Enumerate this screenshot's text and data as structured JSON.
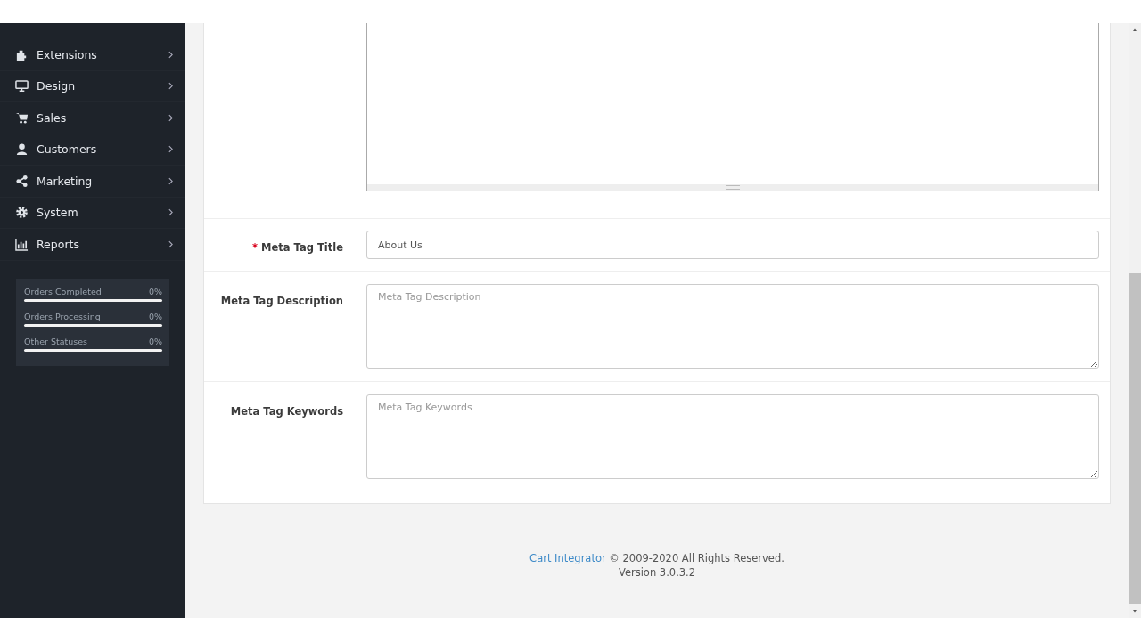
{
  "sidebar": {
    "items": [
      {
        "label": "Extensions"
      },
      {
        "label": "Design"
      },
      {
        "label": "Sales"
      },
      {
        "label": "Customers"
      },
      {
        "label": "Marketing"
      },
      {
        "label": "System"
      },
      {
        "label": "Reports"
      }
    ],
    "stats": [
      {
        "label": "Orders Completed",
        "reading": "0%",
        "level": 0
      },
      {
        "label": "Orders Processing",
        "reading": "0%",
        "level": 0
      },
      {
        "label": "Other Statuses",
        "reading": "0%",
        "level": 0
      }
    ]
  },
  "form": {
    "fields": [
      {
        "kind": "editor"
      },
      {
        "kind": "input",
        "required_mark": "*",
        "label": "Meta Tag Title",
        "value": "About Us"
      },
      {
        "kind": "textarea",
        "label": "Meta Tag Description",
        "placeholder": "Meta Tag Description"
      },
      {
        "kind": "textarea",
        "label": "Meta Tag Keywords",
        "placeholder": "Meta Tag Keywords"
      }
    ]
  },
  "footer": {
    "link": "Cart Integrator",
    "copyright": "© 2009-2020 All Rights Reserved.",
    "version": "Version 3.0.3.2"
  }
}
